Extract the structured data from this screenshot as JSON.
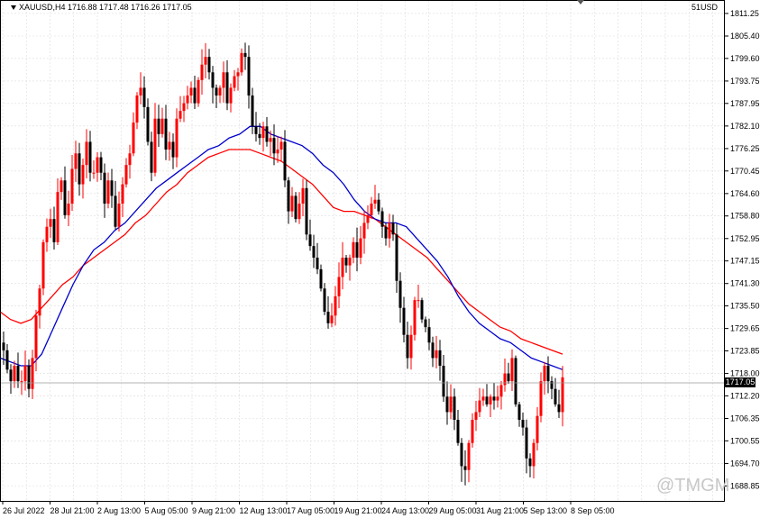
{
  "header": {
    "symbol_line": "XAUUSD,H4  1716.88 1717.48 1716.26 1717.05",
    "broker": "51USD"
  },
  "current_price": "1717.05",
  "watermark": "@TMGM",
  "colors": {
    "bull": "#ff0000",
    "bear": "#000000",
    "ma_fast": "#0000cc",
    "ma_slow": "#ff0000",
    "grid": "#dcdcdc"
  },
  "chart_data": {
    "type": "candlestick",
    "symbol": "XAUUSD",
    "timeframe": "H4",
    "ylim": [
      1685.0,
      1814.5
    ],
    "y_ticks": [
      "1811.25",
      "1805.40",
      "1799.60",
      "1793.75",
      "1787.95",
      "1782.10",
      "1776.25",
      "1770.45",
      "1764.60",
      "1758.80",
      "1752.95",
      "1747.15",
      "1741.30",
      "1735.50",
      "1729.65",
      "1723.85",
      "1718.00",
      "1712.20",
      "1706.35",
      "1700.55",
      "1694.70",
      "1688.85"
    ],
    "x_ticks": [
      "26 Jul 2022",
      "28 Jul 21:00",
      "2 Aug 13:00",
      "5 Aug 05:00",
      "9 Aug 21:00",
      "12 Aug 13:00",
      "17 Aug 05:00",
      "19 Aug 21:00",
      "24 Aug 13:00",
      "29 Aug 05:00",
      "31 Aug 21:00",
      "5 Sep 13:00",
      "8 Sep 05:00"
    ],
    "close_path": [
      1724,
      1719,
      1716,
      1720,
      1716,
      1716,
      1720,
      1714,
      1722,
      1733,
      1740,
      1752,
      1756,
      1758,
      1752,
      1765,
      1768,
      1759,
      1762,
      1771,
      1775,
      1767,
      1772,
      1778,
      1770,
      1770,
      1774,
      1770,
      1762,
      1768,
      1764,
      1756,
      1762,
      1767,
      1772,
      1775,
      1783,
      1790,
      1792,
      1787,
      1778,
      1770,
      1784,
      1780,
      1784,
      1776,
      1778,
      1774,
      1784,
      1786,
      1788,
      1790,
      1792,
      1788,
      1794,
      1798,
      1800,
      1796,
      1792,
      1790,
      1792,
      1796,
      1788,
      1792,
      1795,
      1796,
      1801,
      1800,
      1790,
      1782,
      1780,
      1779,
      1782,
      1778,
      1779,
      1775,
      1776,
      1778,
      1768,
      1760,
      1764,
      1758,
      1762,
      1766,
      1754,
      1751,
      1748,
      1745,
      1740,
      1734,
      1731,
      1733,
      1738,
      1743,
      1748,
      1746,
      1748,
      1752,
      1748,
      1753,
      1757,
      1759,
      1762,
      1763,
      1760,
      1756,
      1753,
      1757,
      1754,
      1742,
      1735,
      1728,
      1722,
      1728,
      1737,
      1737,
      1732,
      1730,
      1726,
      1722,
      1724,
      1720,
      1712,
      1708,
      1712,
      1706,
      1700,
      1694,
      1693,
      1700,
      1706,
      1708,
      1711,
      1712,
      1710,
      1712,
      1711,
      1712,
      1715,
      1718,
      1716,
      1722,
      1710,
      1706,
      1704,
      1696,
      1694,
      1700,
      1707,
      1716,
      1720,
      1716,
      1714,
      1710,
      1708,
      1717
    ],
    "ma_fast": [
      1722,
      1721,
      1720,
      1720,
      1723,
      1729,
      1735,
      1741,
      1746,
      1750,
      1752,
      1755,
      1757,
      1760,
      1763,
      1766,
      1768,
      1770,
      1772,
      1774,
      1776,
      1777,
      1779,
      1780,
      1782,
      1782,
      1780,
      1779,
      1778,
      1777,
      1775,
      1772,
      1770,
      1767,
      1763,
      1760,
      1758,
      1757,
      1757,
      1756,
      1753,
      1750,
      1747,
      1743,
      1738,
      1734,
      1731,
      1729,
      1727,
      1726,
      1724,
      1722,
      1721,
      1720,
      1719
    ],
    "ma_slow": [
      1734,
      1732,
      1731,
      1732,
      1735,
      1738,
      1741,
      1743,
      1746,
      1748,
      1750,
      1752,
      1754,
      1757,
      1759,
      1762,
      1765,
      1767,
      1770,
      1772,
      1774,
      1775,
      1776,
      1776,
      1776,
      1775,
      1774,
      1773,
      1771,
      1769,
      1767,
      1764,
      1761,
      1760,
      1760,
      1759,
      1758,
      1756,
      1754,
      1752,
      1750,
      1748,
      1745,
      1742,
      1739,
      1736,
      1734,
      1732,
      1730,
      1729,
      1727,
      1726,
      1725,
      1724,
      1723
    ],
    "grid": true
  }
}
